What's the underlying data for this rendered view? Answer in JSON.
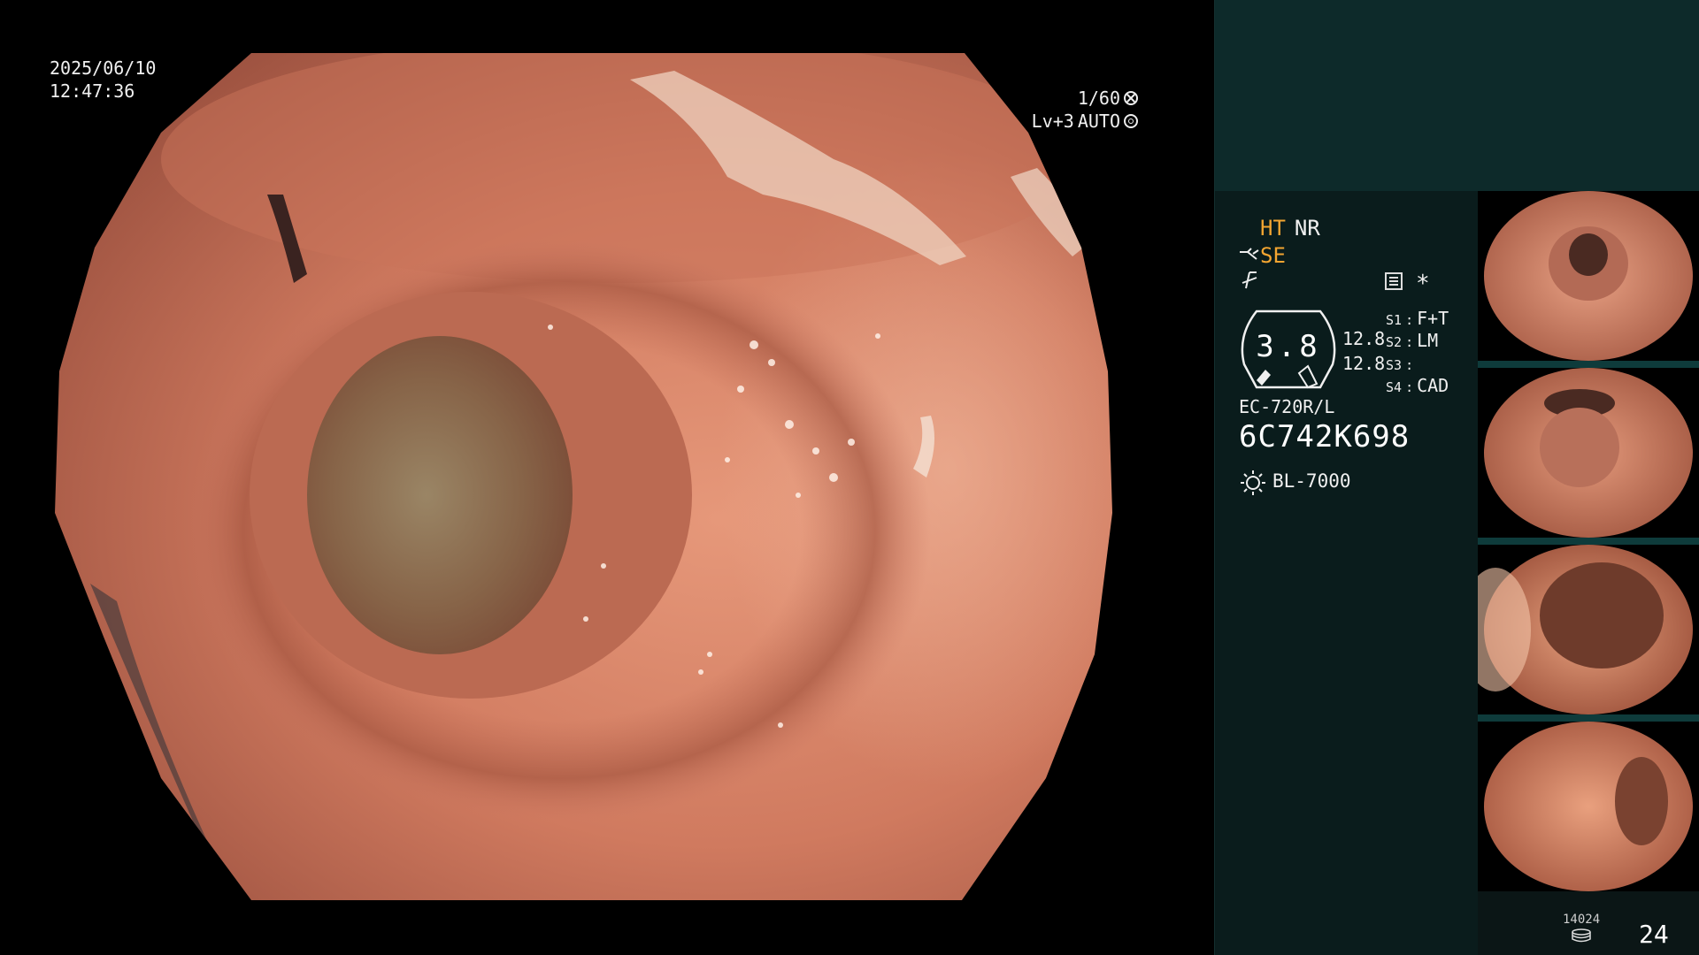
{
  "timestamp": {
    "date": "2025/06/10",
    "time": "12:47:36"
  },
  "exposure": {
    "shutter": "1/60",
    "level": "Lv+3",
    "iris": "AUTO",
    "shutter_icon": "shutter-icon",
    "iris_icon": "iris-icon"
  },
  "modes": {
    "ht": "HT",
    "nr": "NR",
    "se": "SE",
    "se_icon": "scope-tip-icon",
    "flash_icon": "flash-off-icon",
    "menu_icon": "menu-list-icon",
    "star": "*"
  },
  "gauge": {
    "value": "3.8",
    "reading_1": "12.8",
    "reading_2": "12.8"
  },
  "switch_settings": [
    {
      "key": "S1",
      "sep": ":",
      "value": "F+T"
    },
    {
      "key": "S2",
      "sep": ":",
      "value": "LM"
    },
    {
      "key": "S3",
      "sep": ":",
      "value": ""
    },
    {
      "key": "S4",
      "sep": ":",
      "value": "CAD"
    }
  ],
  "scope": {
    "model": "EC-720R/L",
    "serial": "6C742K698"
  },
  "light_source": {
    "icon": "light-source-icon",
    "label": "BL-7000"
  },
  "captures": {
    "count": "14024",
    "page": "24",
    "storage_icon": "database-icon"
  },
  "colors": {
    "accent_orange": "#f3a531",
    "panel_teal": "#0d2a2a",
    "panel_dark": "#0a1c1c",
    "mucosa": "#d07a5f"
  }
}
